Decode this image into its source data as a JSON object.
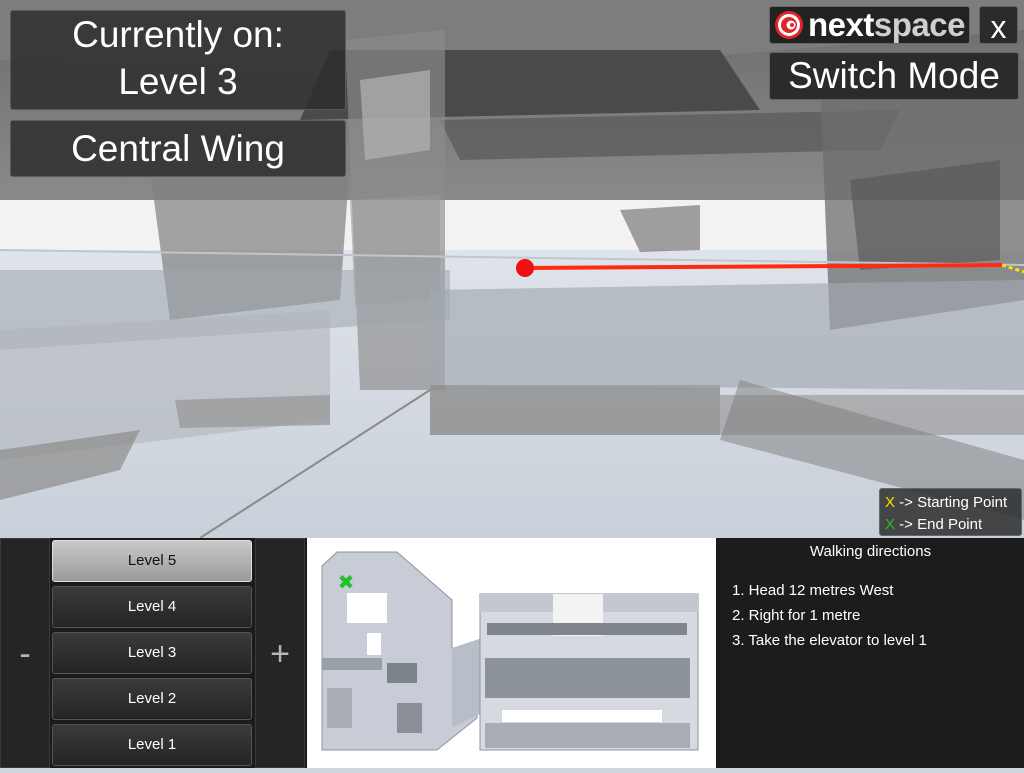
{
  "status": {
    "current_line1": "Currently on:",
    "current_line2": "Level 3",
    "wing": "Central Wing"
  },
  "brand": {
    "name_part1": "next",
    "name_part2": "space",
    "logo_icon": "swirl-logo-icon",
    "logo_color": "#e0242a"
  },
  "controls": {
    "close_label": "x",
    "switch_mode_label": "Switch Mode"
  },
  "legend": {
    "start_marker": "X",
    "start_text": " -> Starting Point",
    "end_marker": "X",
    "end_text": " -> End Point",
    "start_color": "#ffe000",
    "end_color": "#22c22a"
  },
  "floor_selector": {
    "minus_label": "-",
    "plus_label": "+",
    "levels": [
      "Level 5",
      "Level 4",
      "Level 3",
      "Level 2",
      "Level 1"
    ],
    "active_level": "Level 5"
  },
  "route": {
    "line_color": "#ff2a10",
    "start_dot_color": "#ee1111"
  },
  "directions": {
    "title": "Walking directions",
    "steps": [
      "1. Head 12 metres West",
      "2. Right for 1 metre",
      "3. Take the elevator to level 1"
    ]
  }
}
